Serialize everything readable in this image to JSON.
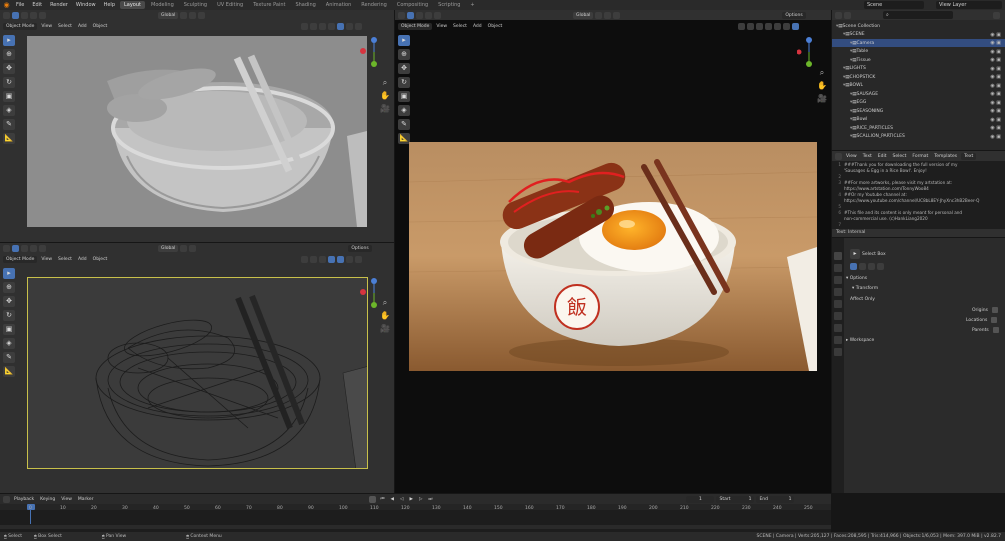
{
  "app": {
    "menus": [
      "File",
      "Edit",
      "Render",
      "Window",
      "Help"
    ],
    "workspaces": [
      "Layout",
      "Modeling",
      "Sculpting",
      "UV Editing",
      "Texture Paint",
      "Shading",
      "Animation",
      "Rendering",
      "Compositing",
      "Scripting"
    ],
    "active_workspace": "Layout",
    "add_tab": "+",
    "scene": "Scene",
    "view_layer": "View Layer"
  },
  "viewport_header": {
    "mode": "Object Mode",
    "view": "View",
    "select": "Select",
    "add": "Add",
    "object": "Object",
    "orientation": "Global",
    "options": "Options"
  },
  "outliner": {
    "rows": [
      {
        "label": "Scene Collection",
        "indent": 0,
        "selected": false
      },
      {
        "label": "SCENE",
        "indent": 1,
        "selected": false
      },
      {
        "label": "Camera",
        "indent": 2,
        "selected": true
      },
      {
        "label": "Table",
        "indent": 2,
        "selected": false
      },
      {
        "label": "Tissue",
        "indent": 2,
        "selected": false
      },
      {
        "label": "LIGHTS",
        "indent": 1,
        "selected": false
      },
      {
        "label": "CHOPSTICK",
        "indent": 1,
        "selected": false
      },
      {
        "label": "BOWL",
        "indent": 1,
        "selected": false
      },
      {
        "label": "SAUSAGE",
        "indent": 2,
        "selected": false
      },
      {
        "label": "EGG",
        "indent": 2,
        "selected": false
      },
      {
        "label": "SEASONING",
        "indent": 2,
        "selected": false
      },
      {
        "label": "Bowl",
        "indent": 2,
        "selected": false
      },
      {
        "label": "RICE_PARTICLES",
        "indent": 2,
        "selected": false
      },
      {
        "label": "SCALLION_PARTICLES",
        "indent": 2,
        "selected": false
      }
    ]
  },
  "text_editor": {
    "menus": [
      "View",
      "Text",
      "Edit",
      "Select",
      "Format",
      "Templates"
    ],
    "file": "Text",
    "lines": [
      {
        "n": "1",
        "t": "###Thank you for downloading the full version of my"
      },
      {
        "n": "",
        "t": "'Sausages & Egg in a Rice Bowl'. Enjoy!"
      },
      {
        "n": "2",
        "t": ""
      },
      {
        "n": "3",
        "t": "##For more artworks, please visit my artstation at:"
      },
      {
        "n": "",
        "t": "https://www.artstation.com/TonnyWoo84"
      },
      {
        "n": "4",
        "t": "##Or my Youtube channel at:"
      },
      {
        "n": "",
        "t": "https://www.youtube.com/channel/UC8bL8EY-JhyXnc3hB2Beer-Q"
      },
      {
        "n": "5",
        "t": ""
      },
      {
        "n": "6",
        "t": "#This file and its content is only meant for personal and"
      },
      {
        "n": "",
        "t": "non-commercial use. (c)HankLiang2020"
      },
      {
        "n": "7",
        "t": ""
      }
    ],
    "status": "Text: Internal"
  },
  "properties": {
    "tool": "Select Box",
    "options": "Options",
    "transform": "Transform",
    "affect_only": "Affect Only",
    "origins": "Origins",
    "locations": "Locations",
    "parents": "Parents",
    "workspace": "Workspace"
  },
  "timeline": {
    "playback": "Playback",
    "keying": "Keying",
    "view": "View",
    "marker": "Marker",
    "current_frame": "1",
    "start_label": "Start",
    "start": "1",
    "end_label": "End",
    "end": "1",
    "ticks": [
      "0",
      "10",
      "20",
      "30",
      "40",
      "50",
      "60",
      "70",
      "80",
      "90",
      "100",
      "110",
      "120",
      "130",
      "140",
      "150",
      "160",
      "170",
      "180",
      "190",
      "200",
      "210",
      "220",
      "230",
      "240",
      "250"
    ]
  },
  "statusbar": {
    "select": "Select",
    "box_select": "Box Select",
    "pan_view": "Pan View",
    "context_menu": "Context Menu",
    "stats": "SCENE | Camera | Verts:205,127 | Faces:208,595 | Tris:414,966 | Objects:1/6,053 | Mem: 397.0 MiB | v2.82.7"
  },
  "colors": {
    "accent": "#4772b3",
    "brand": "#e87d0d",
    "selected_row": "#334d80"
  }
}
